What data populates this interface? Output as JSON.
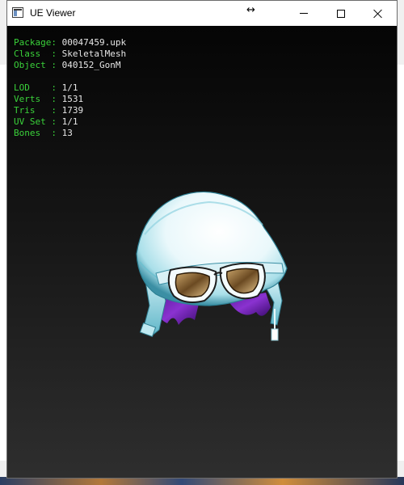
{
  "window": {
    "title": "UE Viewer"
  },
  "info": {
    "package_label": "Package:",
    "package_value": "00047459.upk",
    "class_label": "Class  :",
    "class_value": "SkeletalMesh",
    "object_label": "Object :",
    "object_value": "040152_GonM",
    "lod_label": "LOD    :",
    "lod_value": "1/1",
    "verts_label": "Verts  :",
    "verts_value": "1531",
    "tris_label": "Tris   :",
    "tris_value": "1739",
    "uvset_label": "UV Set :",
    "uvset_value": "1/1",
    "bones_label": "Bones  :",
    "bones_value": "13"
  },
  "colors": {
    "label_green": "#3ad23a",
    "value_white": "#e6e6e6",
    "viewport_top": "#050505",
    "viewport_bottom": "#2e2e2e"
  },
  "icons": {
    "app": "ue-viewer-app-icon",
    "resize": "horizontal-resize-icon",
    "minimize": "minimize-icon",
    "maximize": "maximize-icon",
    "close": "close-icon"
  }
}
